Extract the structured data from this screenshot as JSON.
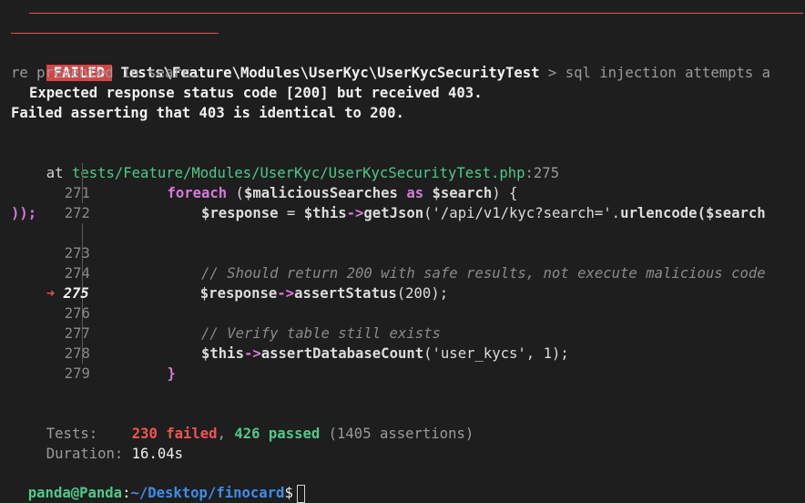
{
  "failure": {
    "badge": "FAILED",
    "test_class": "Tests\\Feature\\Modules\\UserKyc\\UserKycSecurityTest",
    "separator": " > ",
    "test_name_line1": "sql injection attempts a",
    "test_name_line2": "re prevented in searc…",
    "expected_message": "Expected response status code [200] but received 403.",
    "assert_message": "Failed asserting that 403 is identical to 200.",
    "at_label": "at ",
    "file_path": "tests/Feature/Modules/UserKyc/UserKycSecurityTest.php",
    "line_ref": ":275"
  },
  "code": {
    "current_marker": "➜",
    "lines": [
      {
        "num": "271"
      },
      {
        "num": "272",
        "wrap": "));"
      },
      {
        "num": "273"
      },
      {
        "num": "274"
      },
      {
        "num": "275"
      },
      {
        "num": "276"
      },
      {
        "num": "277"
      },
      {
        "num": "278"
      },
      {
        "num": "279"
      }
    ],
    "tokens": {
      "foreach": "foreach",
      "paren_open": " (",
      "malicious": "$maliciousSearches",
      "as": " as ",
      "search": "$search",
      "paren_close_brace": ") {",
      "response": "$response",
      "assign": " = ",
      "this": "$this",
      "arrow": "->",
      "getJson": "getJson",
      "getJson_args": "('/api/v1/kyc?search='.",
      "urlencode": "urlencode",
      "urlencode_args": "($search",
      "comment1": "// Should return 200 with safe results, not execute malicious code",
      "assertStatus": "assertStatus",
      "assertStatus_args": "(200);",
      "comment2": "// Verify table still exists",
      "assertDatabaseCount": "assertDatabaseCount",
      "assertDatabaseCount_args": "('user_kycs', 1);",
      "close_brace": "}"
    }
  },
  "summary": {
    "tests_label": "Tests:",
    "failed": "230 failed",
    "comma": ", ",
    "passed": "426 passed",
    "assertions": " (1405 assertions)",
    "duration_label": "Duration:",
    "duration_value": "16.04s"
  },
  "prompt": {
    "user_host": "panda@Panda",
    "colon": ":",
    "path": "~/Desktop/finocard",
    "symbol": "$"
  },
  "colors": {
    "background": "#1e1e1e",
    "failed_badge": "#d64545",
    "green": "#4ec98b",
    "red": "#f25353",
    "keyword": "#d778d8",
    "prompt_path": "#3b8eea"
  }
}
